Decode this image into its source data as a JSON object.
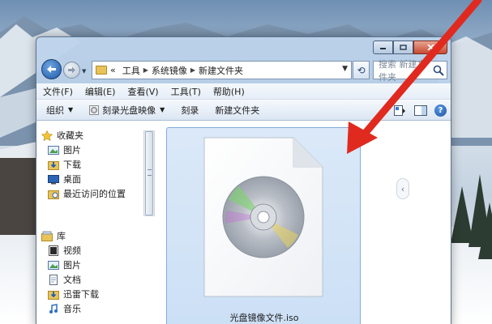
{
  "window": {
    "address_segments": [
      "工具",
      "系统镜像",
      "新建文件夹"
    ],
    "address_prefix": "«",
    "search_placeholder": "搜索 新建文件夹"
  },
  "menubar": {
    "items": [
      "文件(F)",
      "编辑(E)",
      "查看(V)",
      "工具(T)",
      "帮助(H)"
    ]
  },
  "toolbar": {
    "organize": "组织",
    "burn_image": "刻录光盘映像",
    "burn": "刻录",
    "new_folder": "新建文件夹"
  },
  "sidebar": {
    "favorites": {
      "label": "收藏夹",
      "items": [
        "图片",
        "下载",
        "桌面",
        "最近访问的位置"
      ]
    },
    "libraries": {
      "label": "库",
      "items": [
        "视频",
        "图片",
        "文档",
        "迅雷下载",
        "音乐"
      ]
    }
  },
  "main": {
    "file_name": "光盘镜像文件.iso"
  },
  "colors": {
    "annotation_arrow": "#e02a1f",
    "selection": "#cbdff5"
  }
}
